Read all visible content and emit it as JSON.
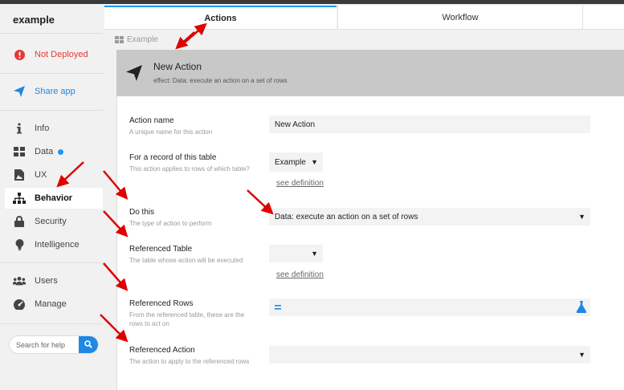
{
  "app": {
    "name": "example"
  },
  "sidebar": {
    "status": {
      "label": "Not Deployed",
      "icon": "alert-circle-icon",
      "color": "#e53935"
    },
    "share": {
      "label": "Share app",
      "icon": "paper-plane-icon",
      "color": "#1e88e5"
    },
    "items": [
      {
        "label": "Info",
        "icon": "info-icon"
      },
      {
        "label": "Data",
        "icon": "grid-icon"
      },
      {
        "label": "UX",
        "icon": "image-icon"
      },
      {
        "label": "Behavior",
        "icon": "sitemap-icon"
      },
      {
        "label": "Security",
        "icon": "lock-icon"
      },
      {
        "label": "Intelligence",
        "icon": "lightbulb-icon"
      },
      {
        "label": "Users",
        "icon": "users-icon"
      },
      {
        "label": "Manage",
        "icon": "gauge-icon"
      }
    ],
    "search": {
      "placeholder": "Search for help"
    }
  },
  "tabs": [
    {
      "label": "Actions",
      "active": true
    },
    {
      "label": "Workflow",
      "active": false
    }
  ],
  "breadcrumb": {
    "label": "Example"
  },
  "action": {
    "title": "New Action",
    "effect": "effect: Data: execute an action on a set of rows"
  },
  "form": {
    "name": {
      "label": "Action name",
      "desc": "A unique name for this action",
      "value": "New Action"
    },
    "table": {
      "label": "For a record of this table",
      "desc": "This action applies to rows of which table?",
      "value": "Example",
      "link": "see definition"
    },
    "do_this": {
      "label": "Do this",
      "desc": "The type of action to perform",
      "value": "Data: execute an action on a set of rows"
    },
    "ref_table": {
      "label": "Referenced Table",
      "desc": "The table whose action will be executed",
      "value": "",
      "link": "see definition"
    },
    "ref_rows": {
      "label": "Referenced Rows",
      "desc": "From the referenced table, these are the rows to act on",
      "value": ""
    },
    "ref_action": {
      "label": "Referenced Action",
      "desc": "The action to apply to the referenced rows",
      "value": ""
    }
  },
  "colors": {
    "accent": "#2196f3",
    "annotation": "#e00000"
  }
}
